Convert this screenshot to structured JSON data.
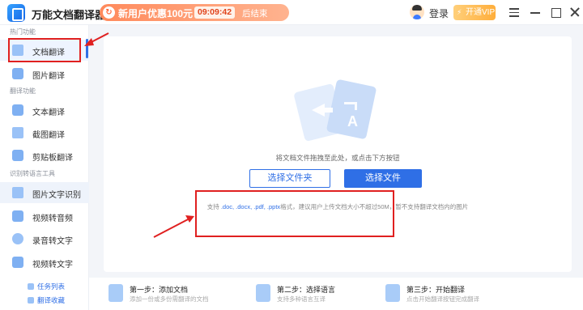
{
  "titlebar": {
    "app_title": "万能文档翻译器",
    "promo_badge": "↻",
    "promo_text": "新用户优惠100元",
    "promo_timer": "09:09:42",
    "promo_end": "后结束",
    "login": "登录",
    "vip": "开通VIP"
  },
  "sidebar": {
    "group_hot": "热门功能",
    "group_translate": "翻译功能",
    "group_ocr": "识别转语言工具",
    "items": [
      {
        "label": "文档翻译"
      },
      {
        "label": "图片翻译"
      },
      {
        "label": "文本翻译"
      },
      {
        "label": "截图翻译"
      },
      {
        "label": "剪贴板翻译"
      },
      {
        "label": "图片文字识别"
      },
      {
        "label": "视频转音频"
      },
      {
        "label": "录音转文字"
      },
      {
        "label": "视频转文字"
      }
    ],
    "footer": {
      "tasks": "任务列表",
      "favorites": "翻译收藏"
    }
  },
  "main": {
    "drop_hint": "将文档文件拖拽至此处，或点击下方按钮",
    "select_folder": "选择文件夹",
    "select_file": "选择文件",
    "support_prefix": "支持",
    "support_formats": ".doc, .docx, .pdf, .pptx",
    "support_suffix": "格式，建议用户上传文档大小不超过50M，暂不支持翻译文档内的图片"
  },
  "steps": [
    {
      "title": "第一步：添加文档",
      "desc": "添加一份或多份需翻译的文档"
    },
    {
      "title": "第二步：选择语言",
      "desc": "支持多种语言互译"
    },
    {
      "title": "第三步：开始翻译",
      "desc": "点击开始翻译按钮完成翻译"
    }
  ],
  "colors": {
    "accent": "#2f6fe6",
    "annotation": "#e02020",
    "promo": "#ff8a5c",
    "vip": "#ffae3b"
  }
}
